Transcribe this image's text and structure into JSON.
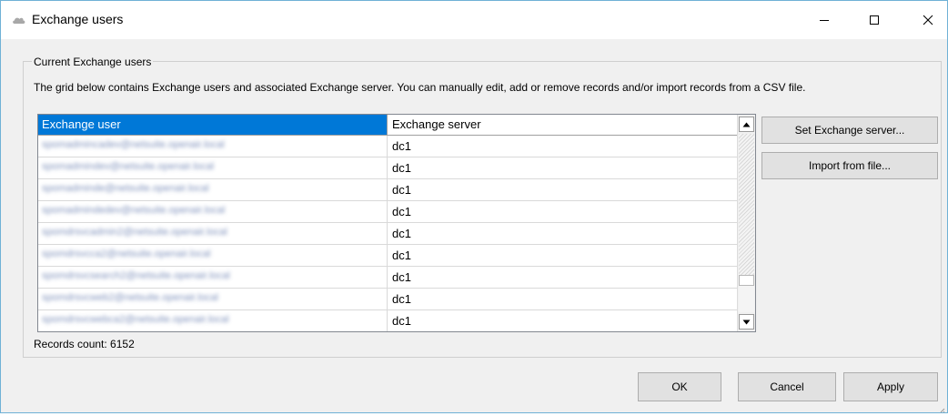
{
  "window": {
    "title": "Exchange users",
    "icon": "cloud-icon",
    "controls": [
      "minimize-icon",
      "maximize-icon",
      "close-icon"
    ]
  },
  "group": {
    "legend": "Current Exchange users",
    "description": "The grid below contains Exchange users and associated Exchange server. You can manually edit, add or remove records and/or import records from a CSV file."
  },
  "grid": {
    "columns": [
      "Exchange user",
      "Exchange server"
    ],
    "rows": [
      {
        "user": "spomadmincadev@netsuite.openair.local",
        "server": "dc1"
      },
      {
        "user": "spomadmindev@netsuite.openair.local",
        "server": "dc1"
      },
      {
        "user": "spomadminde@netsuite.openair.local",
        "server": "dc1"
      },
      {
        "user": "spomadmindedev@netsuite.openair.local",
        "server": "dc1"
      },
      {
        "user": "spomdrsvcadmin2@netsuite.openair.local",
        "server": "dc1"
      },
      {
        "user": "spomdrsvcca2@netsuite.openair.local",
        "server": "dc1"
      },
      {
        "user": "spomdrsvcsearch2@netsuite.openair.local",
        "server": "dc1"
      },
      {
        "user": "spomdrsvcweb2@netsuite.openair.local",
        "server": "dc1"
      },
      {
        "user": "spomdrsvcwebca2@netsuite.openair.local",
        "server": "dc1"
      }
    ]
  },
  "buttons": {
    "set_server": "Set Exchange server...",
    "import": "Import from file...",
    "ok": "OK",
    "cancel": "Cancel",
    "apply": "Apply"
  },
  "records_count": "Records count: 6152",
  "colors": {
    "selected_header": "#0078d7",
    "window_bg": "#f0f0f0",
    "button_bg": "#e1e1e1",
    "border_accent": "#6fb1d6"
  }
}
